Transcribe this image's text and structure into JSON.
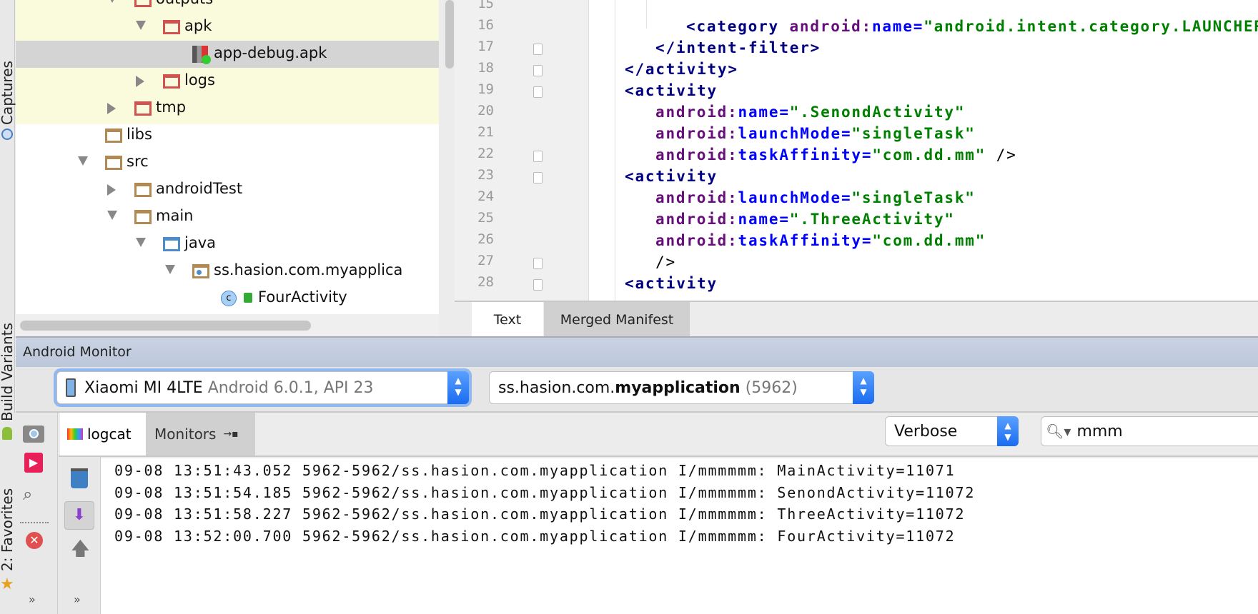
{
  "side_strip": {
    "captures": "Captures",
    "build_variants": "Build Variants",
    "favorites": "2: Favorites"
  },
  "project_tree": [
    {
      "label": "outputs",
      "level": 3,
      "icon": "folder-red",
      "arrow": "open"
    },
    {
      "label": "apk",
      "level": 4,
      "icon": "folder-red",
      "arrow": "open"
    },
    {
      "label": "app-debug.apk",
      "level": 5,
      "icon": "apk-file-icon",
      "arrow": "none",
      "selected": true
    },
    {
      "label": "logs",
      "level": 4,
      "icon": "folder-red",
      "arrow": "closed"
    },
    {
      "label": "tmp",
      "level": 3,
      "icon": "folder-red",
      "arrow": "closed"
    },
    {
      "label": "libs",
      "level": 2,
      "icon": "folder",
      "arrow": "none"
    },
    {
      "label": "src",
      "level": 2,
      "icon": "folder",
      "arrow": "open"
    },
    {
      "label": "androidTest",
      "level": 3,
      "icon": "folder",
      "arrow": "closed"
    },
    {
      "label": "main",
      "level": 3,
      "icon": "folder",
      "arrow": "open"
    },
    {
      "label": "java",
      "level": 4,
      "icon": "folder-blue",
      "arrow": "open"
    },
    {
      "label": "ss.hasion.com.myapplica",
      "level": 5,
      "icon": "package-icon",
      "arrow": "open"
    },
    {
      "label": "FourActivity",
      "level": 6,
      "icon": "class-icon",
      "arrow": "none"
    }
  ],
  "editor": {
    "lines": [
      {
        "n": "15",
        "indent": 0,
        "parts": []
      },
      {
        "n": "16",
        "indent": 3,
        "parts": [
          [
            "tag",
            "<category "
          ],
          [
            "ns",
            "android:"
          ],
          [
            "att",
            "name="
          ],
          [
            "val",
            "\"android.intent.category.LAUNCHER\""
          ],
          [
            "tag",
            " />"
          ]
        ]
      },
      {
        "n": "17",
        "indent": 2,
        "parts": [
          [
            "tag",
            "</intent-filter>"
          ]
        ]
      },
      {
        "n": "18",
        "indent": 1,
        "parts": [
          [
            "tag",
            "</activity>"
          ]
        ]
      },
      {
        "n": "19",
        "indent": 1,
        "parts": [
          [
            "tag",
            "<activity"
          ]
        ]
      },
      {
        "n": "20",
        "indent": 2,
        "parts": [
          [
            "ns",
            "android:"
          ],
          [
            "att",
            "name="
          ],
          [
            "val",
            "\".SenondActivity\""
          ]
        ]
      },
      {
        "n": "21",
        "indent": 2,
        "parts": [
          [
            "ns",
            "android:"
          ],
          [
            "att",
            "launchMode="
          ],
          [
            "val",
            "\"singleTask\""
          ]
        ]
      },
      {
        "n": "22",
        "indent": 2,
        "parts": [
          [
            "ns",
            "android:"
          ],
          [
            "att",
            "taskAffinity="
          ],
          [
            "val",
            "\"com.dd.mm\""
          ],
          [
            "plain",
            " />"
          ]
        ]
      },
      {
        "n": "23",
        "indent": 1,
        "parts": [
          [
            "tag",
            "<activity"
          ]
        ]
      },
      {
        "n": "24",
        "indent": 2,
        "parts": [
          [
            "ns",
            "android:"
          ],
          [
            "att",
            "launchMode="
          ],
          [
            "val",
            "\"singleTask\""
          ]
        ]
      },
      {
        "n": "25",
        "indent": 2,
        "parts": [
          [
            "ns",
            "android:"
          ],
          [
            "att",
            "name="
          ],
          [
            "val",
            "\".ThreeActivity\""
          ]
        ]
      },
      {
        "n": "26",
        "indent": 2,
        "parts": [
          [
            "ns",
            "android:"
          ],
          [
            "att",
            "taskAffinity="
          ],
          [
            "val",
            "\"com.dd.mm\""
          ]
        ]
      },
      {
        "n": "27",
        "indent": 2,
        "parts": [
          [
            "plain",
            "/>"
          ]
        ]
      },
      {
        "n": "28",
        "indent": 1,
        "parts": [
          [
            "tag",
            "<activity"
          ]
        ]
      }
    ],
    "tabs": {
      "text": "Text",
      "merged": "Merged Manifest"
    }
  },
  "monitor": {
    "title": "Android Monitor",
    "device": {
      "name": "Xiaomi MI 4LTE",
      "detail": "Android 6.0.1, API 23"
    },
    "process": {
      "prefix": "ss.hasion.com.",
      "bold": "myapplication",
      "pid": "(5962)"
    },
    "tabs": {
      "logcat": "logcat",
      "monitors": "Monitors"
    },
    "level": "Verbose",
    "search": "mmm",
    "more": "»",
    "log_lines": [
      "09-08 13:51:43.052 5962-5962/ss.hasion.com.myapplication I/mmmmmm: MainActivity=11071",
      "09-08 13:51:54.185 5962-5962/ss.hasion.com.myapplication I/mmmmmm: SenondActivity=11072",
      "09-08 13:51:58.227 5962-5962/ss.hasion.com.myapplication I/mmmmmm: ThreeActivity=11072",
      "09-08 13:52:00.700 5962-5962/ss.hasion.com.myapplication I/mmmmmm: FourActivity=11072"
    ]
  }
}
